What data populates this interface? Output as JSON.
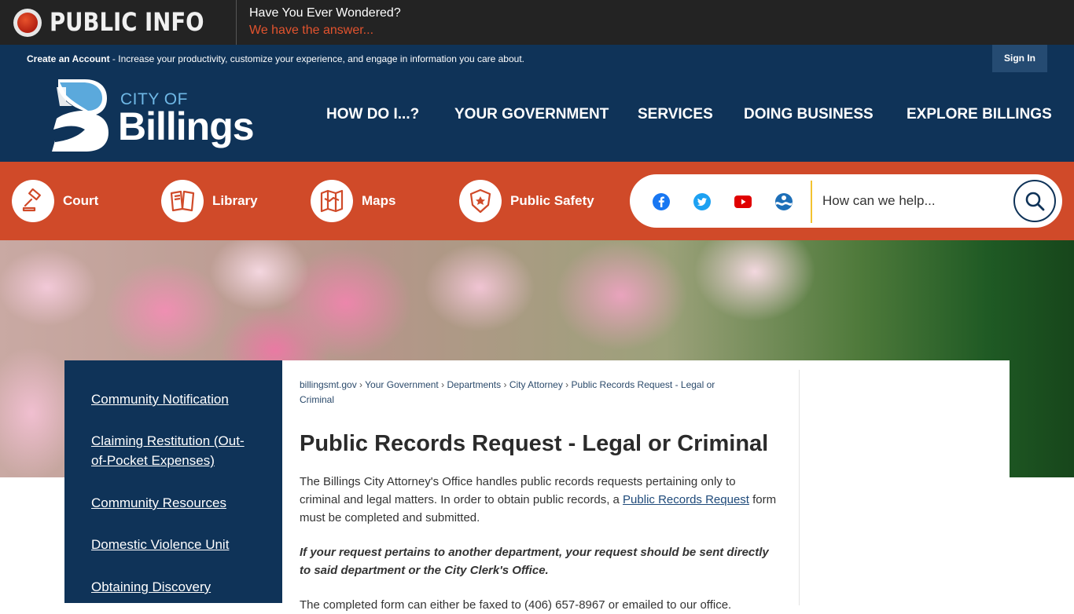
{
  "public_info": {
    "title": "PUBLIC INFO",
    "question": "Have You Ever Wondered?",
    "answer": "We have the answer..."
  },
  "account_bar": {
    "create_link": "Create an Account",
    "description": " - Increase your productivity, customize your experience, and engage in information you care about.",
    "sign_in": "Sign In"
  },
  "logo": {
    "city_of": "CITY OF",
    "name": "Billings"
  },
  "main_nav": [
    "HOW DO I...?",
    "YOUR GOVERNMENT",
    "SERVICES",
    "DOING BUSINESS",
    "EXPLORE BILLINGS"
  ],
  "quick_links": [
    {
      "label": "Court",
      "icon": "gavel-icon"
    },
    {
      "label": "Library",
      "icon": "book-icon"
    },
    {
      "label": "Maps",
      "icon": "map-icon"
    },
    {
      "label": "Public Safety",
      "icon": "police-badge-icon"
    }
  ],
  "social": [
    "facebook-icon",
    "twitter-icon",
    "youtube-icon",
    "noaa-icon"
  ],
  "search": {
    "placeholder": "How can we help..."
  },
  "side_nav": [
    "Community Notification",
    "Claiming Restitution (Out-of-Pocket Expenses)",
    "Community Resources",
    "Domestic Violence Unit",
    "Obtaining Discovery"
  ],
  "breadcrumb": [
    "billingsmt.gov",
    "Your Government",
    "Departments",
    "City Attorney",
    "Public Records Request - Legal or Criminal"
  ],
  "page": {
    "title": "Public Records Request - Legal or Criminal",
    "para1_before": "The Billings City Attorney's Office handles public records requests pertaining only to criminal and legal matters.  In order to obtain public records, a ",
    "para1_link": "Public Records Request",
    "para1_after": " form must be completed and submitted.",
    "para2": "If your request pertains to another department, your request should be sent directly to said department or the City Clerk's Office.",
    "para3": "The completed form can either be faxed to (406) 657-8967 or emailed to our office."
  },
  "colors": {
    "navy": "#0f3358",
    "orange": "#d04a29",
    "accent_red": "#e2532e",
    "search_separator": "#f2c230"
  }
}
